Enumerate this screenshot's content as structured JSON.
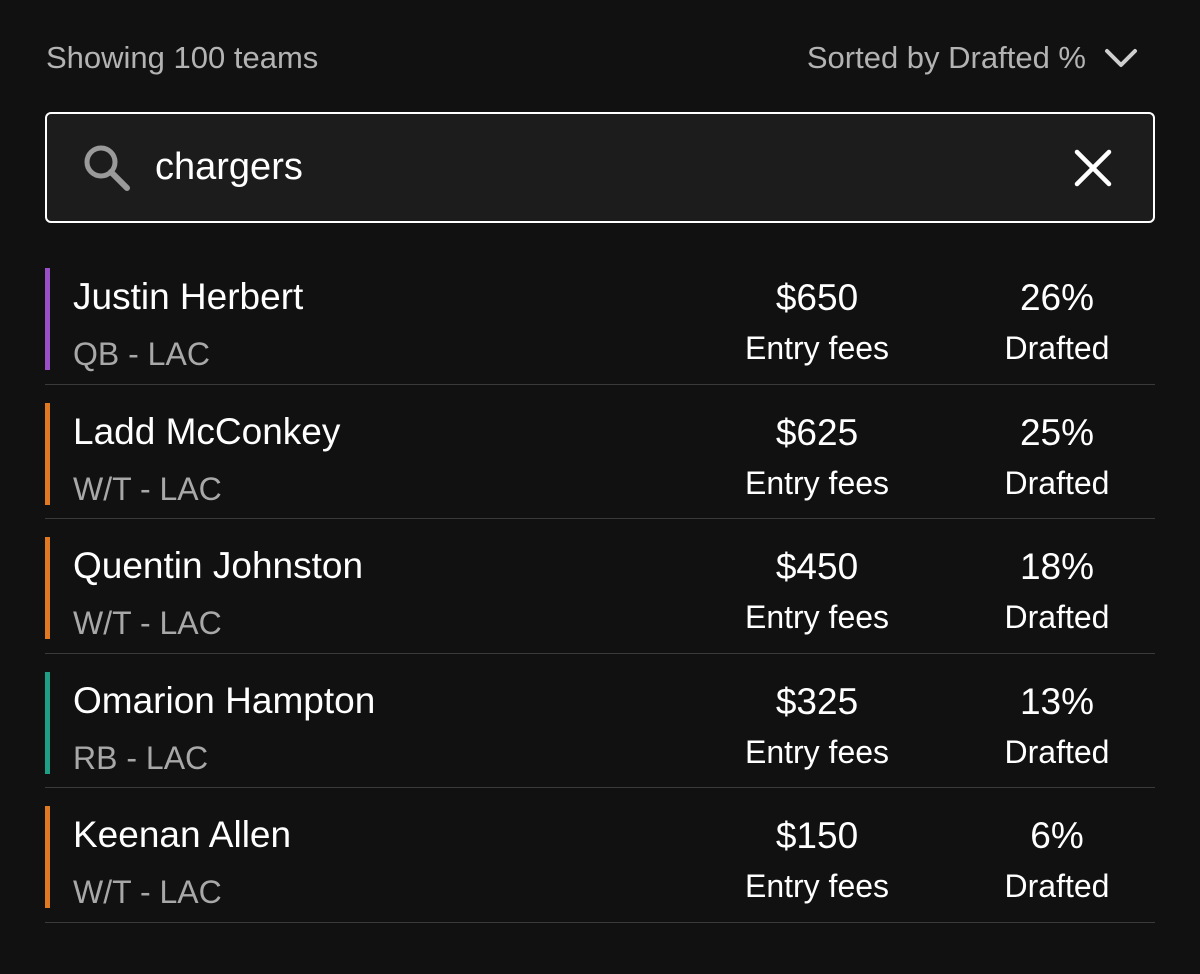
{
  "header": {
    "showing_text": "Showing 100 teams",
    "sort_label": "Sorted by Drafted %",
    "sort_icon": "chevron-down-icon"
  },
  "search": {
    "value": "chargers",
    "icon": "search-icon",
    "clear_icon": "close-icon"
  },
  "players": [
    {
      "name": "Justin Herbert",
      "position": "QB - LAC",
      "fees": "$650",
      "fees_label": "Entry fees",
      "drafted": "26%",
      "drafted_label": "Drafted",
      "color": "#9b4fc7"
    },
    {
      "name": "Ladd McConkey",
      "position": "W/T - LAC",
      "fees": "$625",
      "fees_label": "Entry fees",
      "drafted": "25%",
      "drafted_label": "Drafted",
      "color": "#e07a22"
    },
    {
      "name": "Quentin Johnston",
      "position": "W/T - LAC",
      "fees": "$450",
      "fees_label": "Entry fees",
      "drafted": "18%",
      "drafted_label": "Drafted",
      "color": "#e07a22"
    },
    {
      "name": "Omarion Hampton",
      "position": "RB - LAC",
      "fees": "$325",
      "fees_label": "Entry fees",
      "drafted": "13%",
      "drafted_label": "Drafted",
      "color": "#1f9e86"
    },
    {
      "name": "Keenan Allen",
      "position": "W/T - LAC",
      "fees": "$150",
      "fees_label": "Entry fees",
      "drafted": "6%",
      "drafted_label": "Drafted",
      "color": "#e07a22"
    }
  ]
}
